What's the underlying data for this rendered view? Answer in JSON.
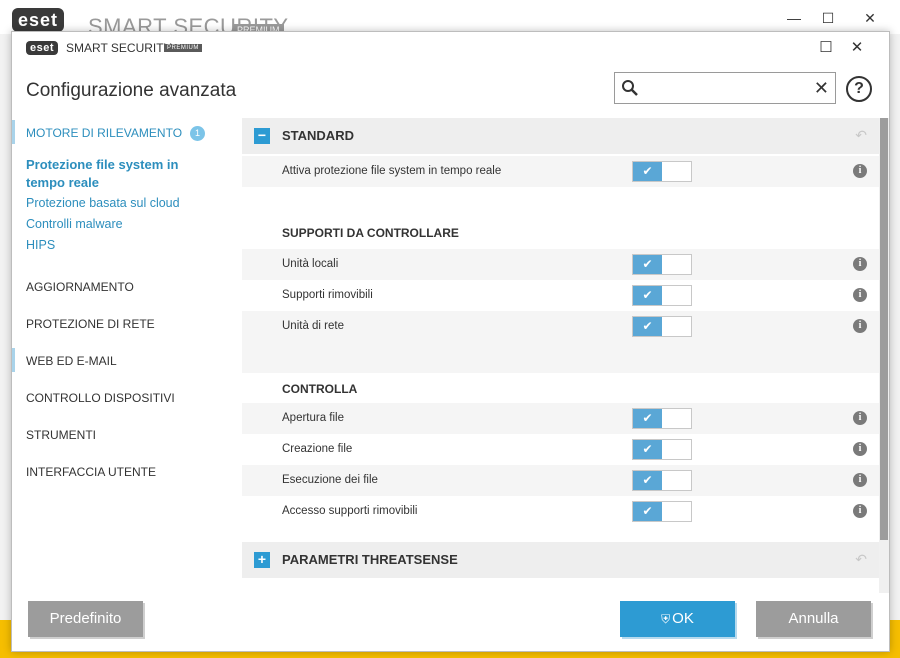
{
  "background_window": {
    "logo": "eset",
    "title": "SMART SECURITY",
    "badge": "PREMIUM",
    "controls": [
      "—",
      "☐",
      "✕"
    ]
  },
  "dialog": {
    "logo": "eset",
    "product": "SMART SECURITY",
    "badge": "PREMIUM",
    "controls": {
      "maximize": "☐",
      "close": "✕"
    },
    "title": "Configurazione avanzata"
  },
  "search": {
    "value": "",
    "placeholder": "",
    "clear": "✕"
  },
  "help": "?",
  "sidebar": {
    "items": [
      {
        "label": "MOTORE DI RILEVAMENTO",
        "count": "1"
      },
      {
        "label": "AGGIORNAMENTO"
      },
      {
        "label": "PROTEZIONE DI RETE"
      },
      {
        "label": "WEB ED E-MAIL"
      },
      {
        "label": "CONTROLLO DISPOSITIVI"
      },
      {
        "label": "STRUMENTI"
      },
      {
        "label": "INTERFACCIA UTENTE"
      }
    ],
    "subitems": [
      "Protezione file system in tempo reale",
      "Protezione basata sul cloud",
      "Controlli malware",
      "HIPS"
    ]
  },
  "content": {
    "sections": [
      {
        "title": "STANDARD",
        "toggle": "−",
        "undo": "↶"
      },
      {
        "title": "PARAMETRI THREATSENSE",
        "toggle": "+",
        "undo": "↶"
      }
    ],
    "main_setting": {
      "label": "Attiva protezione file system in tempo reale",
      "enabled": true
    },
    "media_group": {
      "heading": "SUPPORTI DA CONTROLLARE",
      "rows": [
        {
          "label": "Unità locali",
          "enabled": true
        },
        {
          "label": "Supporti rimovibili",
          "enabled": true
        },
        {
          "label": "Unità di rete",
          "enabled": true
        }
      ]
    },
    "scan_group": {
      "heading": "CONTROLLA",
      "rows": [
        {
          "label": "Apertura file",
          "enabled": true
        },
        {
          "label": "Creazione file",
          "enabled": true
        },
        {
          "label": "Esecuzione dei file",
          "enabled": true
        },
        {
          "label": "Accesso supporti rimovibili",
          "enabled": true
        }
      ]
    },
    "check_glyph": "✔",
    "info_glyph": "i"
  },
  "footer": {
    "default_label": "Predefinito",
    "ok_label": "OK",
    "cancel_label": "Annulla"
  },
  "colors": {
    "accent": "#2d9bd3",
    "switch_on": "#5aa7d6",
    "button_gray": "#9c9c9c",
    "link": "#2c8ebd"
  },
  "icons": [
    "search-icon",
    "close-icon",
    "help-icon",
    "info-icon",
    "check-icon",
    "undo-icon",
    "shield-icon",
    "minus-icon",
    "plus-icon"
  ]
}
